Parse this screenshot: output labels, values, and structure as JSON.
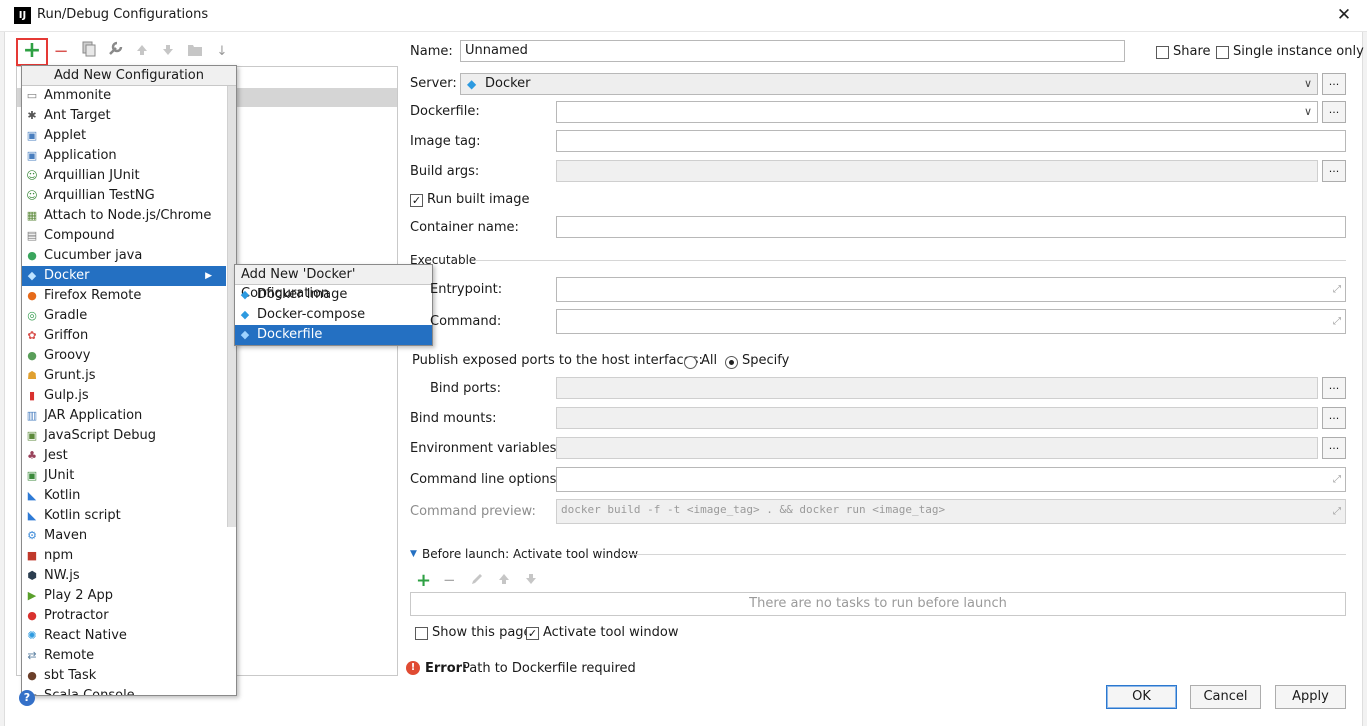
{
  "window": {
    "title": "Run/Debug Configurations",
    "app_icon": "IJ",
    "close_symbol": "✕"
  },
  "toolbar": {
    "add_symbol": "+",
    "remove_symbol": "−",
    "folder_symbol": "▬",
    "sort_symbol": "↓"
  },
  "menu": {
    "header": "Add New Configuration",
    "items": [
      {
        "label": "Ammonite",
        "icon": "ammonite-icon",
        "glyph": "▭",
        "color": "#7a7a7a"
      },
      {
        "label": "Ant Target",
        "icon": "ant-icon",
        "glyph": "✱",
        "color": "#555555"
      },
      {
        "label": "Applet",
        "icon": "applet-icon",
        "glyph": "▣",
        "color": "#4a7fbf"
      },
      {
        "label": "Application",
        "icon": "application-icon",
        "glyph": "▣",
        "color": "#4a7fbf"
      },
      {
        "label": "Arquillian JUnit",
        "icon": "arquillian-icon",
        "glyph": "☺",
        "color": "#3c8a3c"
      },
      {
        "label": "Arquillian TestNG",
        "icon": "arquillian-icon",
        "glyph": "☺",
        "color": "#3c8a3c"
      },
      {
        "label": "Attach to Node.js/Chrome",
        "icon": "attach-icon",
        "glyph": "▦",
        "color": "#5d8a3c"
      },
      {
        "label": "Compound",
        "icon": "compound-icon",
        "glyph": "▤",
        "color": "#7a7a7a"
      },
      {
        "label": "Cucumber java",
        "icon": "cucumber-icon",
        "glyph": "●",
        "color": "#3aa55d"
      },
      {
        "label": "Docker",
        "icon": "docker-icon",
        "glyph": "◆",
        "color": "#2d9ae0",
        "submenu": true
      },
      {
        "label": "Firefox Remote",
        "icon": "firefox-icon",
        "glyph": "●",
        "color": "#e66a1a"
      },
      {
        "label": "Gradle",
        "icon": "gradle-icon",
        "glyph": "◎",
        "color": "#2f9b4a"
      },
      {
        "label": "Griffon",
        "icon": "griffon-icon",
        "glyph": "✿",
        "color": "#d9534f"
      },
      {
        "label": "Groovy",
        "icon": "groovy-icon",
        "glyph": "●",
        "color": "#5a9e5a"
      },
      {
        "label": "Grunt.js",
        "icon": "grunt-icon",
        "glyph": "☗",
        "color": "#e0a030"
      },
      {
        "label": "Gulp.js",
        "icon": "gulp-icon",
        "glyph": "▮",
        "color": "#d9322f"
      },
      {
        "label": "JAR Application",
        "icon": "jar-icon",
        "glyph": "▥",
        "color": "#4a7fbf"
      },
      {
        "label": "JavaScript Debug",
        "icon": "js-debug-icon",
        "glyph": "▣",
        "color": "#5d8a3c"
      },
      {
        "label": "Jest",
        "icon": "jest-icon",
        "glyph": "♣",
        "color": "#99425b"
      },
      {
        "label": "JUnit",
        "icon": "junit-icon",
        "glyph": "▣",
        "color": "#3c8a3c"
      },
      {
        "label": "Kotlin",
        "icon": "kotlin-icon",
        "glyph": "◣",
        "color": "#2f7bd6"
      },
      {
        "label": "Kotlin script",
        "icon": "kotlin-icon",
        "glyph": "◣",
        "color": "#2f7bd6"
      },
      {
        "label": "Maven",
        "icon": "maven-icon",
        "glyph": "⚙",
        "color": "#3c8ad8"
      },
      {
        "label": "npm",
        "icon": "npm-icon",
        "glyph": "■",
        "color": "#c0392b"
      },
      {
        "label": "NW.js",
        "icon": "nwjs-icon",
        "glyph": "⬢",
        "color": "#2c3e50"
      },
      {
        "label": "Play 2 App",
        "icon": "play-icon",
        "glyph": "▶",
        "color": "#5aa02c"
      },
      {
        "label": "Protractor",
        "icon": "protractor-icon",
        "glyph": "●",
        "color": "#d9322f"
      },
      {
        "label": "React Native",
        "icon": "react-icon",
        "glyph": "✺",
        "color": "#2d9ae0"
      },
      {
        "label": "Remote",
        "icon": "remote-icon",
        "glyph": "⇄",
        "color": "#5a7fa0"
      },
      {
        "label": "sbt Task",
        "icon": "sbt-icon",
        "glyph": "●",
        "color": "#6b3f2a"
      },
      {
        "label": "Scala Console",
        "icon": "scala-icon",
        "glyph": "▭",
        "color": "#7a7a7a"
      }
    ]
  },
  "submenu": {
    "header": "Add New 'Docker' Configuration",
    "items": [
      {
        "label": "Docker Image",
        "icon": "docker-icon"
      },
      {
        "label": "Docker-compose",
        "icon": "docker-icon"
      },
      {
        "label": "Dockerfile",
        "icon": "docker-icon",
        "selected": true
      }
    ]
  },
  "form": {
    "name_label": "Name:",
    "name_value": "Unnamed",
    "share_label": "Share",
    "single_instance_label": "Single instance only",
    "server_label": "Server:",
    "server_value": "Docker",
    "dockerfile_label": "Dockerfile:",
    "image_tag_label": "Image tag:",
    "build_args_label": "Build args:",
    "run_built_image_label": "Run built image",
    "container_name_label": "Container name:",
    "executable_label": "Executable",
    "entrypoint_label": "Entrypoint:",
    "command_label": "Command:",
    "publish_label": "Publish exposed ports to the host interfaces:",
    "publish_all": "All",
    "publish_specify": "Specify",
    "bind_ports_label": "Bind ports:",
    "bind_mounts_label": "Bind mounts:",
    "env_vars_label": "Environment variables:",
    "cmd_options_label": "Command line options:",
    "cmd_preview_label": "Command preview:",
    "cmd_preview_value": "docker build -f  -t <image_tag> . && docker run <image_tag>",
    "dots": "...",
    "expand": "⤢",
    "dropdown_arrow": "∨"
  },
  "before_launch": {
    "title": "Before launch: Activate tool window",
    "empty_text": "There are no tasks to run before launch",
    "show_page_label": "Show this page",
    "activate_label": "Activate tool window"
  },
  "error": {
    "prefix": "Error:",
    "message": "Path to Dockerfile required"
  },
  "buttons": {
    "ok": "OK",
    "cancel": "Cancel",
    "apply": "Apply"
  },
  "colors": {
    "selection": "#2470c2",
    "highlight_box": "#e53935",
    "add_green": "#2ea043",
    "error_red": "#e04b33"
  }
}
